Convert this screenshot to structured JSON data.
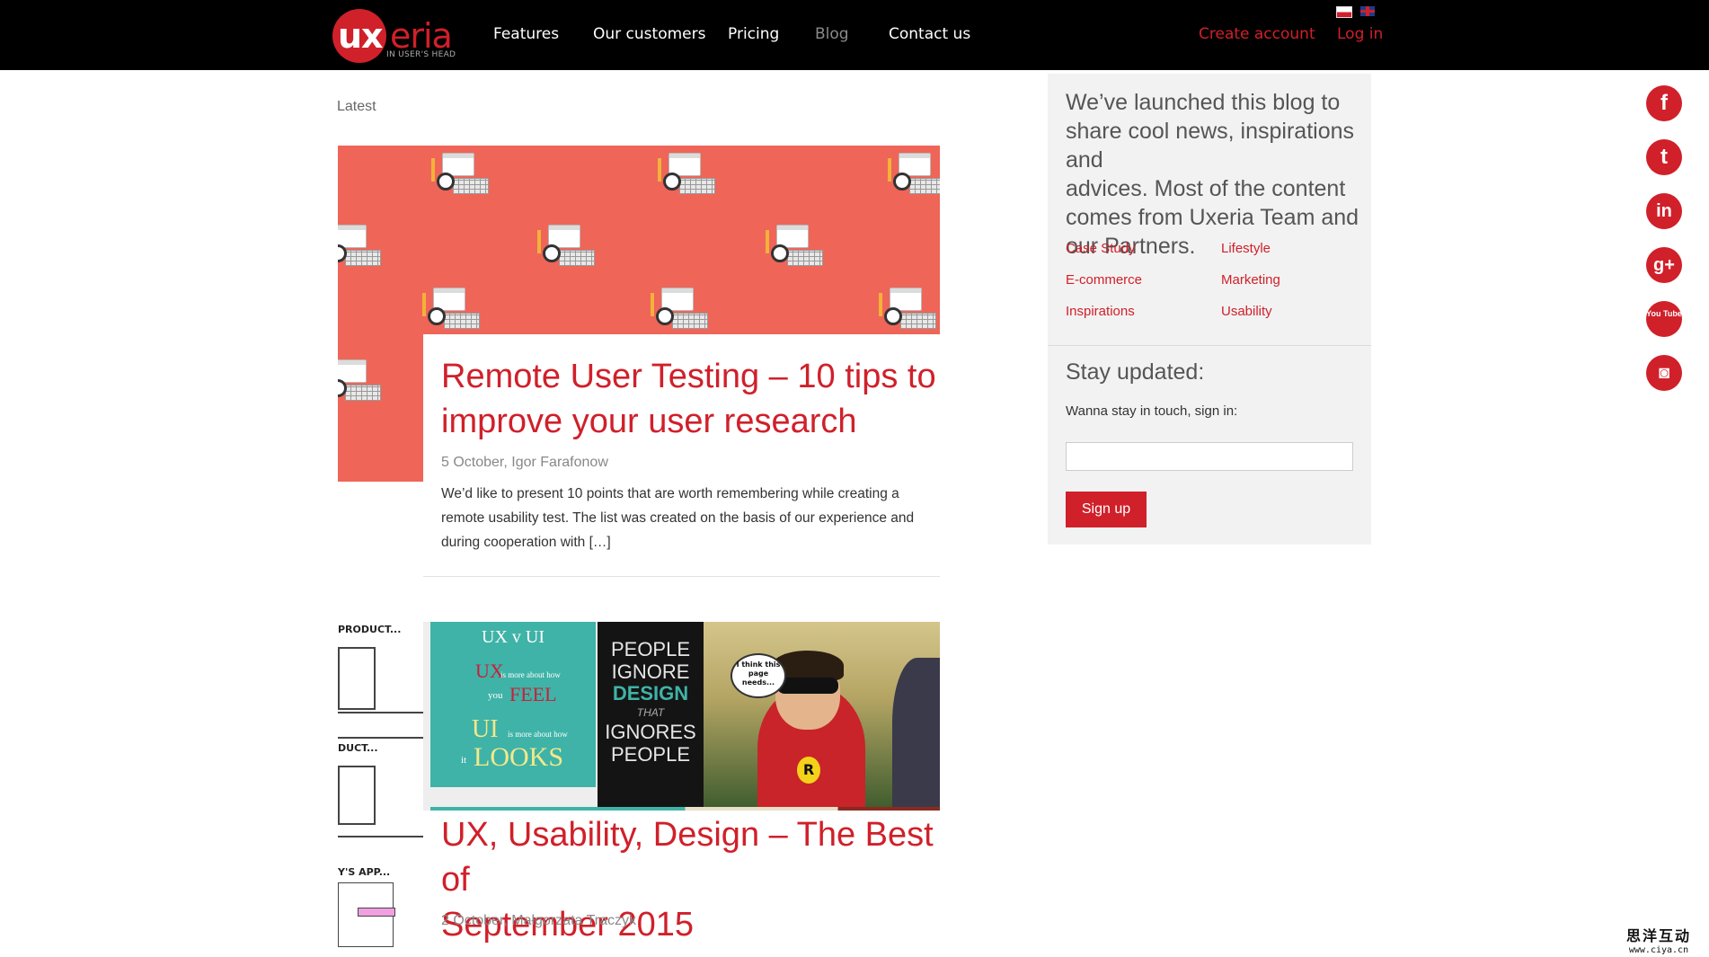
{
  "header": {
    "logo_text": "uxeria",
    "logo_tagline": "IN USER'S HEAD",
    "nav": [
      "Features",
      "Our customers",
      "Pricing",
      "Blog",
      "Contact us"
    ],
    "create_account": "Create account",
    "login": "Log in",
    "languages": [
      "pl",
      "en"
    ]
  },
  "main": {
    "section_label": "Latest",
    "posts": [
      {
        "title": "Remote User Testing – 10 tips to improve your user research",
        "title_line1": "Remote User Testing – 10 tips to",
        "title_line2": "improve your user research",
        "meta": "5 October, Igor Farafonow",
        "excerpt_lines": [
          "We’d like to present 10 points that are worth remembering while creating a",
          "remote usability test. The list was created on the basis of our experience and",
          "during cooperation with […]"
        ]
      },
      {
        "title": "UX, Usability, Design – The Best of September 2015",
        "title_line1": "UX, Usability, Design – The Best of",
        "title_line2": "September 2015",
        "meta": "2 October, Małgorzata Traczyk",
        "image_texts": {
          "wire_1": "PRODUCT...",
          "wire_2": "DUCT...",
          "wire_3": "Y'S APP...",
          "ux_v_ui": "UX v UI",
          "ux": "UX",
          "feel": "FEEL",
          "ui": "UI",
          "looks": "LOOKS",
          "ux_small": "is more about how",
          "you": "you",
          "ui_small": "is more about how",
          "it": "it",
          "p1": "PEOPLE",
          "p2": "IGNORE",
          "p3": "DESIGN",
          "p4": "THAT",
          "p5": "IGNORES",
          "p6": "PEOPLE",
          "bubble": "I think this page needs..."
        }
      }
    ]
  },
  "sidebar": {
    "intro_lines": [
      "We’ve launched this blog to",
      "share cool news, inspirations and",
      "advices. Most of the content",
      "comes from Uxeria Team and",
      "our Partners."
    ],
    "categories": [
      "Case Study",
      "Lifestyle",
      "E-commerce",
      "Marketing",
      "Inspirations",
      "Usability"
    ],
    "stay_title": "Stay updated:",
    "stay_sub": "Wanna stay in touch, sign in:",
    "email_value": "",
    "signup_label": "Sign up"
  },
  "social": {
    "icons": [
      "facebook-icon",
      "twitter-icon",
      "linkedin-icon",
      "google-plus-icon",
      "youtube-icon",
      "instagram-icon"
    ],
    "glyphs": [
      "f",
      "t",
      "in",
      "g+",
      "You Tube",
      "◙"
    ]
  },
  "watermark": {
    "chinese": "思洋互动",
    "url": "www.ciya.cn"
  },
  "colors": {
    "brand_red": "#d0202a",
    "header_bg": "#000000",
    "sidebar_bg": "#f2f2f2",
    "hero_coral": "#ef6558"
  }
}
